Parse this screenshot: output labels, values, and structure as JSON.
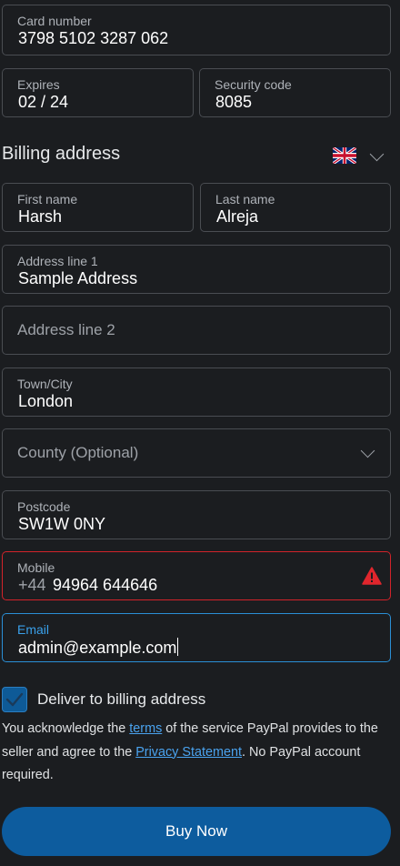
{
  "card": {
    "number_label": "Card number",
    "number_value": "3798 5102 3287 062",
    "expires_label": "Expires",
    "expires_value": "02 / 24",
    "security_label": "Security code",
    "security_value": "8085"
  },
  "billing": {
    "title": "Billing address",
    "country_flag_icon": "uk-flag-icon",
    "first_name_label": "First name",
    "first_name_value": "Harsh",
    "last_name_label": "Last name",
    "last_name_value": "Alreja",
    "address1_label": "Address line 1",
    "address1_value": "Sample Address",
    "address2_placeholder": "Address line 2",
    "town_label": "Town/City",
    "town_value": "London",
    "county_placeholder": "County (Optional)",
    "postcode_label": "Postcode",
    "postcode_value": "SW1W 0NY",
    "mobile_label": "Mobile",
    "mobile_prefix": "+44",
    "mobile_value": "94964 644646",
    "email_label": "Email",
    "email_value": "admin@example.com"
  },
  "deliver": {
    "label": "Deliver to billing address",
    "checked": true
  },
  "legal": {
    "text1": "You acknowledge the ",
    "terms_link": "terms",
    "text2": " of the service PayPal provides to the seller and agree to the ",
    "privacy_link": "Privacy Statement",
    "text3": ". No PayPal account required."
  },
  "buy_button": "Buy Now",
  "colors": {
    "background": "#1b1d20",
    "accent": "#0d5c9e",
    "error": "#d2232a",
    "focus": "#2a8fd6"
  }
}
